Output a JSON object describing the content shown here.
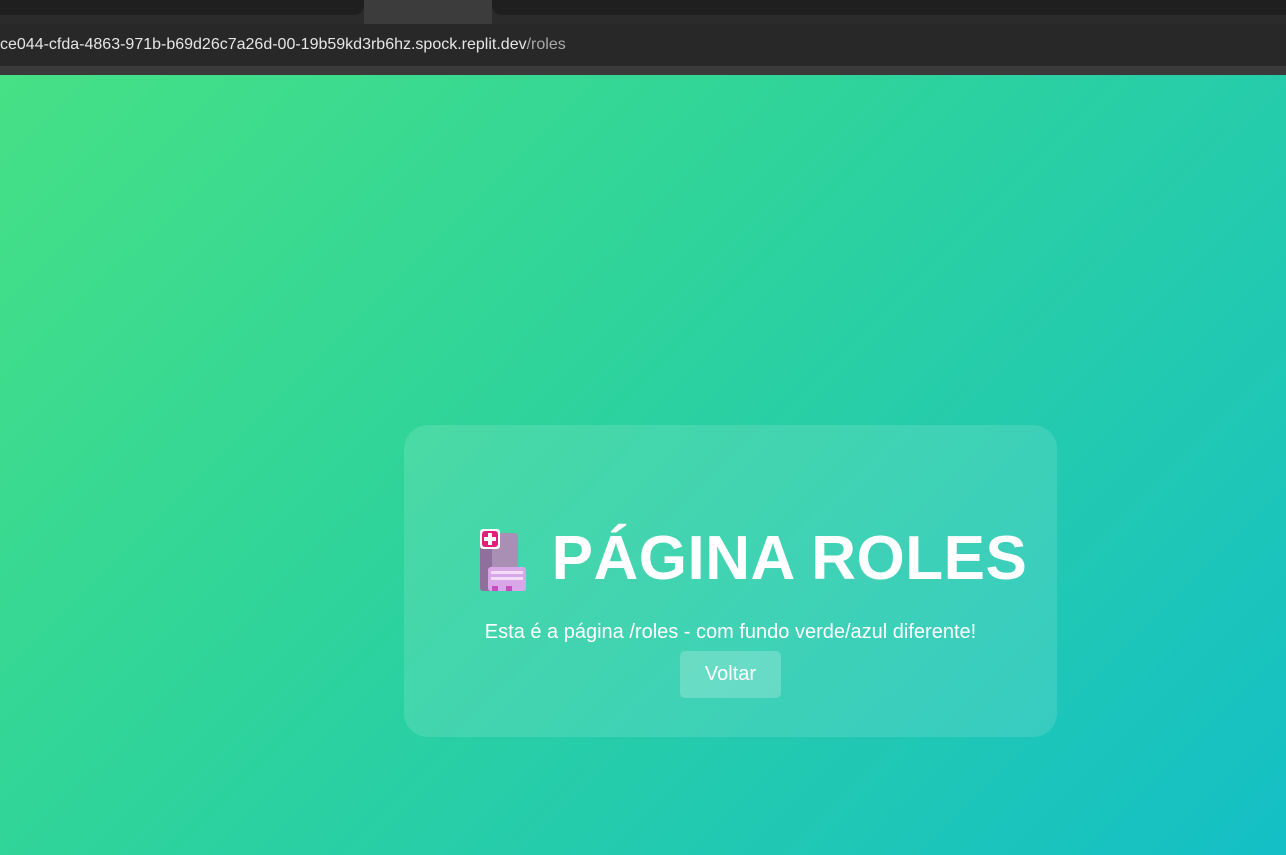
{
  "browser": {
    "url_host": "ce044-cfda-4863-971b-b69d26c7a26d-00-19b59kd3rb6hz.spock.replit.dev",
    "url_path": "/roles"
  },
  "card": {
    "icon": "hospital-icon",
    "title": "PÁGINA ROLES",
    "subtitle": "Esta é a página /roles - com fundo verde/azul diferente!",
    "back_button_label": "Voltar"
  },
  "colors": {
    "gradient_start": "#46e085",
    "gradient_end": "#14bfc6",
    "text": "#ffffff"
  }
}
